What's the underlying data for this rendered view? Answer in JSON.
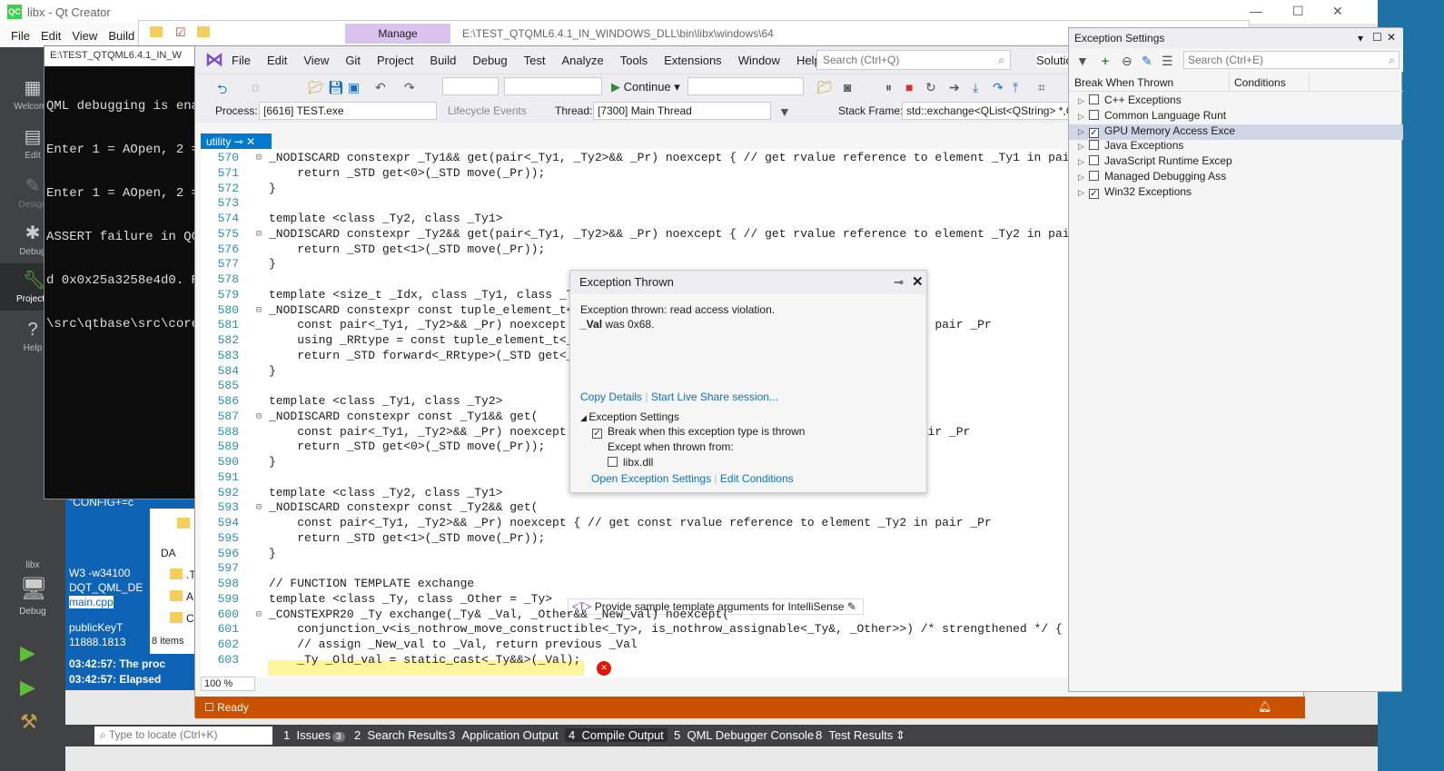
{
  "qt": {
    "title": "libx - Qt Creator",
    "logo": "QC",
    "menu": [
      "File",
      "Edit",
      "View",
      "Build"
    ],
    "sidebar": [
      "Welcome",
      "Edit",
      "Design",
      "Debug",
      "Projects",
      "Help"
    ],
    "kit": {
      "name": "libx",
      "mode": "Debug"
    },
    "locate_placeholder": "Type to locate (Ctrl+K)",
    "bottom_tabs": [
      {
        "num": "1",
        "label": "Issues",
        "badge": "3"
      },
      {
        "num": "2",
        "label": "Search Results"
      },
      {
        "num": "3",
        "label": "Application Output"
      },
      {
        "num": "4",
        "label": "Compile Output"
      },
      {
        "num": "5",
        "label": "QML Debugger Console"
      },
      {
        "num": "8",
        "label": "Test Results"
      }
    ],
    "items_count": "8 items"
  },
  "console": {
    "title": "E:\\TEST_QTQML6.4.1_IN_W",
    "lines": [
      "QML debugging is enab",
      "Enter 1 = AOpen, 2 =",
      "Enter 1 = AOpen, 2 =",
      "ASSERT failure in QCo",
      "d 0x0x25a3258e4d0. Re",
      "\\src\\qtbase\\src\\corel"
    ]
  },
  "explorer": {
    "manage": "Manage",
    "path": "E:\\TEST_QTQML6.4.1_IN_WINDOWS_DLL\\bin\\libx\\windows\\64"
  },
  "build_log": [
    "\"CONFIG+=c",
    "W3 -w34100",
    "DQT_QML_DE",
    "main.cpp",
    "publicKeyT",
    "11888.1813",
    "03:42:57: The proc",
    "03:42:57: Elapsed"
  ],
  "folders": [
    ".T",
    "A",
    "C",
    "DA"
  ],
  "vs": {
    "menu": [
      "File",
      "Edit",
      "View",
      "Git",
      "Project",
      "Build",
      "Debug",
      "Test",
      "Analyze",
      "Tools",
      "Extensions",
      "Window",
      "Help"
    ],
    "search_placeholder": "Search (Ctrl+Q)",
    "solution_label": "Solutio",
    "continue_label": "Continue",
    "process_label": "Process:",
    "process_value": "[6616] TEST.exe",
    "lifecycle_label": "Lifecycle Events",
    "thread_label": "Thread:",
    "thread_value": "[7300] Main Thread",
    "stack_label": "Stack Frame:",
    "stack_value": "std::exchange<QList<QString> *,C",
    "doc_tab": "utility",
    "zoom": "100 %",
    "status": "Ready",
    "intellisense_tag": "<T>",
    "intellisense_text": "Provide sample template arguments for IntelliSense"
  },
  "code_lines": [
    {
      "n": "570",
      "t": "_NODISCARD constexpr _Ty1&& get(pair<_Ty1, _Ty2>&& _Pr) noexcept { // get rvalue reference to element _Ty1 in pai"
    },
    {
      "n": "571",
      "t": "    return _STD get<0>(_STD move(_Pr));"
    },
    {
      "n": "572",
      "t": "}"
    },
    {
      "n": "573",
      "t": ""
    },
    {
      "n": "574",
      "t": "template <class _Ty2, class _Ty1>"
    },
    {
      "n": "575",
      "t": "_NODISCARD constexpr _Ty2&& get(pair<_Ty1, _Ty2>&& _Pr) noexcept { // get rvalue reference to element _Ty2 in pai"
    },
    {
      "n": "576",
      "t": "    return _STD get<1>(_STD move(_Pr));"
    },
    {
      "n": "577",
      "t": "}"
    },
    {
      "n": "578",
      "t": ""
    },
    {
      "n": "579",
      "t": "template <size_t _Idx, class _Ty1, class _T"
    },
    {
      "n": "580",
      "t": "_NODISCARD constexpr const tuple_element_t<"
    },
    {
      "n": "581",
      "t": "    const pair<_Ty1, _Ty2>&& _Pr) noexcept                                                 in pair _Pr"
    },
    {
      "n": "582",
      "t": "    using _RRtype = const tuple_element_t<_"
    },
    {
      "n": "583",
      "t": "    return _STD forward<_RRtype>(_STD get<_"
    },
    {
      "n": "584",
      "t": "}"
    },
    {
      "n": "585",
      "t": ""
    },
    {
      "n": "586",
      "t": "template <class _Ty1, class _Ty2>"
    },
    {
      "n": "587",
      "t": "_NODISCARD constexpr const _Ty1&& get("
    },
    {
      "n": "588",
      "t": "    const pair<_Ty1, _Ty2>&& _Pr) noexcept                                                 pair _Pr"
    },
    {
      "n": "589",
      "t": "    return _STD get<0>(_STD move(_Pr));"
    },
    {
      "n": "590",
      "t": "}"
    },
    {
      "n": "591",
      "t": ""
    },
    {
      "n": "592",
      "t": "template <class _Ty2, class _Ty1>"
    },
    {
      "n": "593",
      "t": "_NODISCARD constexpr const _Ty2&& get("
    },
    {
      "n": "594",
      "t": "    const pair<_Ty1, _Ty2>&& _Pr) noexcept { // get const rvalue reference to element _Ty2 in pair _Pr"
    },
    {
      "n": "595",
      "t": "    return _STD get<1>(_STD move(_Pr));"
    },
    {
      "n": "596",
      "t": "}"
    },
    {
      "n": "597",
      "t": ""
    },
    {
      "n": "598",
      "t": "// FUNCTION TEMPLATE exchange"
    },
    {
      "n": "599",
      "t": "template <class _Ty, class _Other = _Ty>"
    },
    {
      "n": "600",
      "t": "_CONSTEXPR20 _Ty exchange(_Ty& _Val, _Other&& _New_val) noexcept("
    },
    {
      "n": "601",
      "t": "    conjunction_v<is_nothrow_move_constructible<_Ty>, is_nothrow_assignable<_Ty&, _Other>>) /* strengthened */ {"
    },
    {
      "n": "602",
      "t": "    // assign _New_val to _Val, return previous _Val"
    },
    {
      "n": "603",
      "t": "    _Ty _Old_val = static_cast<_Ty&&>(_Val);"
    }
  ],
  "exception_popup": {
    "title": "Exception Thrown",
    "message": "Exception thrown: read access violation.",
    "detail_var": "_Val",
    "detail_rest": " was 0x68.",
    "copy_details": "Copy Details",
    "live_share": "Start Live Share session...",
    "settings_header": "Exception Settings",
    "break_when": "Break when this exception type is thrown",
    "except_when": "Except when thrown from:",
    "module": "libx.dll",
    "open_settings": "Open Exception Settings",
    "edit_conditions": "Edit Conditions"
  },
  "exception_settings": {
    "title": "Exception Settings",
    "search_placeholder": "Search (Ctrl+E)",
    "col_break": "Break When Thrown",
    "col_conditions": "Conditions",
    "rows": [
      {
        "label": "C++ Exceptions",
        "checked": false
      },
      {
        "label": "Common Language Runt",
        "checked": false
      },
      {
        "label": "GPU Memory Access Exce",
        "checked": true
      },
      {
        "label": "Java Exceptions",
        "checked": false
      },
      {
        "label": "JavaScript Runtime Excep",
        "checked": false
      },
      {
        "label": "Managed Debugging Ass",
        "checked": false
      },
      {
        "label": "Win32 Exceptions",
        "checked": true
      }
    ]
  }
}
